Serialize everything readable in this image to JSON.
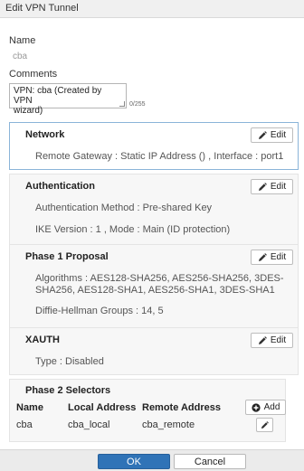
{
  "window": {
    "title": "Edit VPN Tunnel"
  },
  "form": {
    "name_label": "Name",
    "name_value": "cba",
    "comments_label": "Comments",
    "comments_line1": "VPN: cba (Created by VPN",
    "comments_line2": "wizard)",
    "comments_counter": "0/255"
  },
  "sections": {
    "network": {
      "title": "Network",
      "edit_label": "Edit",
      "line1": "Remote Gateway : Static IP Address () , Interface : port1"
    },
    "authentication": {
      "title": "Authentication",
      "edit_label": "Edit",
      "line1": "Authentication Method : Pre-shared Key",
      "line2": "IKE Version : 1 , Mode : Main (ID protection)"
    },
    "phase1": {
      "title": "Phase 1 Proposal",
      "edit_label": "Edit",
      "line1": "Algorithms : AES128-SHA256, AES256-SHA256, 3DES-",
      "line2": "SHA256, AES128-SHA1, AES256-SHA1, 3DES-SHA1",
      "line3": "Diffie-Hellman Groups : 14, 5"
    },
    "xauth": {
      "title": "XAUTH",
      "edit_label": "Edit",
      "line1": "Type : Disabled"
    },
    "phase2": {
      "title": "Phase 2 Selectors",
      "add_label": "Add",
      "columns": [
        "Name",
        "Local Address",
        "Remote Address"
      ],
      "rows": [
        {
          "name": "cba",
          "local": "cba_local",
          "remote": "cba_remote"
        }
      ]
    }
  },
  "footer": {
    "ok_label": "OK",
    "cancel_label": "Cancel"
  },
  "icons": {
    "edit": "pencil-icon",
    "add": "plus-circle-icon"
  },
  "colors": {
    "primary": "#2f73b7",
    "active_border": "#8ab4d8"
  }
}
